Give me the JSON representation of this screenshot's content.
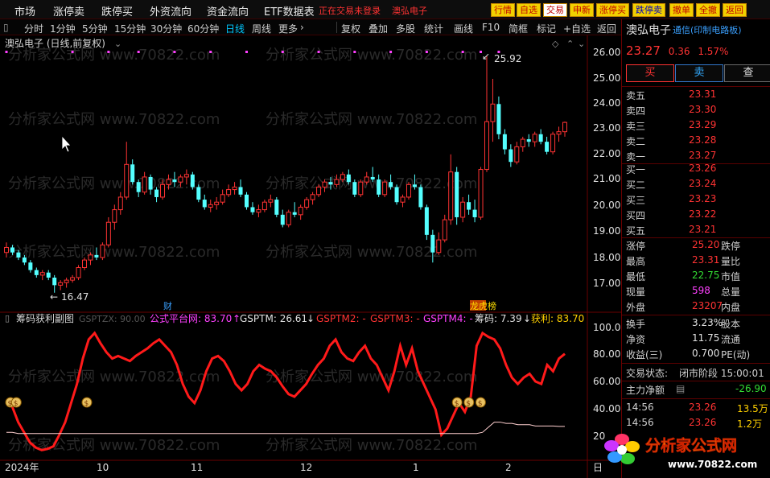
{
  "menu": {
    "items": [
      "市场",
      "涨停卖",
      "跌停买",
      "外资流向",
      "资金流向",
      "ETF数据表"
    ],
    "warning": "正在交易未登录",
    "stock_hint": "澳弘电子"
  },
  "toolbar": {
    "buttons": [
      "行情",
      "自选",
      "交易",
      "申新",
      "涨停买",
      "跌停卖",
      "撤单",
      "全撤",
      "返回"
    ]
  },
  "period_bar": {
    "items": [
      "分时",
      "1分钟",
      "5分钟",
      "15分钟",
      "30分钟",
      "60分钟",
      "日线",
      "周线",
      "更多"
    ],
    "active": "日线",
    "tools": [
      "复权",
      "叠加",
      "多股",
      "统计",
      "画线",
      "F10",
      "简框",
      "标记",
      "+自选",
      "返回"
    ]
  },
  "main_chart": {
    "title": "澳弘电子 (日线,前复权)",
    "watermark": "分析家公式网 www.70822.com",
    "high_label": "25.92",
    "low_label": "16.47",
    "marker_cai": "财",
    "marker_ban": "龙虎榜",
    "y_ticks": [
      "26.00",
      "25.00",
      "24.00",
      "23.00",
      "22.00",
      "21.00",
      "20.00",
      "19.00",
      "18.00",
      "17.00"
    ]
  },
  "sub_chart": {
    "title": "筹码获利副图",
    "params": "GSPTZX: 90.00",
    "legend": [
      {
        "text": "公式平台网: 83.70",
        "color": "#ff40ff"
      },
      {
        "text": "GSPTM: 26.61",
        "color": "#e0e0e0"
      },
      {
        "text": "GSPTM2: -",
        "color": "#ff3333"
      },
      {
        "text": "GSPTM3: -",
        "color": "#ff3333"
      },
      {
        "text": "GSPTM4: -",
        "color": "#ff40ff"
      },
      {
        "text": "筹码: 7.39",
        "color": "#e0e0e0"
      },
      {
        "text": "获利: 83.70",
        "color": "#ffd000"
      }
    ],
    "y_ticks": [
      "100.0",
      "80.00",
      "60.00",
      "40.00",
      "20"
    ]
  },
  "x_axis": {
    "labels": [
      "2024年",
      "10",
      "11",
      "12",
      "1",
      "2"
    ],
    "right_label": "日"
  },
  "quote": {
    "name": "澳弘电子",
    "category": "通信(印制电路板)",
    "price": "23.27",
    "change": "0.36",
    "change_pct": "1.57%",
    "buttons": [
      "买",
      "卖",
      "查"
    ],
    "sell_levels": [
      {
        "label": "卖五",
        "price": "23.31"
      },
      {
        "label": "卖四",
        "price": "23.30"
      },
      {
        "label": "卖三",
        "price": "23.29"
      },
      {
        "label": "卖二",
        "price": "23.28"
      },
      {
        "label": "卖一",
        "price": "23.27"
      }
    ],
    "buy_levels": [
      {
        "label": "买一",
        "price": "23.26"
      },
      {
        "label": "买二",
        "price": "23.24"
      },
      {
        "label": "买三",
        "price": "23.23"
      },
      {
        "label": "买四",
        "price": "23.22"
      },
      {
        "label": "买五",
        "price": "23.21"
      }
    ],
    "stats": [
      {
        "label": "涨停",
        "value": "25.20",
        "label2": "跌停",
        "color": "#ff3333"
      },
      {
        "label": "最高",
        "value": "23.31",
        "label2": "量比",
        "color": "#ff3333"
      },
      {
        "label": "最低",
        "value": "22.75",
        "label2": "市值",
        "color": "#33dd33"
      },
      {
        "label": "现量",
        "value": "598",
        "label2": "总量",
        "color": "#ff40ff"
      },
      {
        "label": "外盘",
        "value": "23207",
        "label2": "内盘",
        "color": "#ff3333"
      }
    ],
    "stats2": [
      {
        "label": "换手",
        "value": "3.23%",
        "label2": "股本",
        "color": "#e0e0e0"
      },
      {
        "label": "净资",
        "value": "11.75",
        "label2": "流通",
        "color": "#e0e0e0"
      },
      {
        "label": "收益(三)",
        "value": "0.700",
        "label2": "PE(动)",
        "color": "#e0e0e0"
      }
    ],
    "status_label": "交易状态:",
    "status_value": "闭市阶段 15:00:01",
    "net_label": "主力净额",
    "net_value": "-26.90",
    "ticks": [
      {
        "time": "14:56",
        "price": "23.26",
        "vol": "13.5万"
      },
      {
        "time": "14:56",
        "price": "23.26",
        "vol": "1.2万"
      }
    ]
  },
  "logo": {
    "name": "分析家公式网",
    "url": "www.70822.com"
  },
  "colors": {
    "up": "#ff3333",
    "down": "#54ffff",
    "line": "#ff1a1a",
    "accent": "#00c8ff"
  },
  "chart_data": {
    "type": "candlestick",
    "price_range": [
      16.3,
      26.6
    ],
    "candles": [
      [
        18.1,
        18.5,
        17.9,
        18.3
      ],
      [
        18.3,
        18.4,
        18.0,
        18.1
      ],
      [
        18.1,
        18.2,
        17.8,
        17.9
      ],
      [
        17.9,
        18.0,
        17.6,
        17.7
      ],
      [
        17.7,
        17.8,
        17.3,
        17.4
      ],
      [
        17.4,
        17.5,
        17.1,
        17.2
      ],
      [
        17.2,
        17.4,
        17.0,
        17.3
      ],
      [
        17.3,
        17.4,
        17.0,
        17.1
      ],
      [
        17.1,
        17.2,
        16.5,
        16.8
      ],
      [
        16.8,
        17.0,
        16.6,
        16.9
      ],
      [
        16.9,
        17.1,
        16.7,
        17.0
      ],
      [
        17.0,
        17.2,
        16.9,
        17.1
      ],
      [
        17.1,
        17.6,
        17.0,
        17.5
      ],
      [
        17.5,
        17.9,
        17.4,
        17.8
      ],
      [
        17.8,
        18.1,
        17.6,
        18.0
      ],
      [
        18.0,
        18.3,
        17.8,
        17.9
      ],
      [
        17.9,
        18.5,
        17.8,
        18.4
      ],
      [
        18.4,
        19.5,
        18.3,
        19.3
      ],
      [
        19.3,
        20.0,
        19.0,
        19.8
      ],
      [
        19.8,
        20.5,
        19.6,
        20.3
      ],
      [
        20.3,
        22.5,
        20.2,
        21.6
      ],
      [
        21.6,
        21.8,
        20.8,
        20.9
      ],
      [
        20.9,
        21.0,
        20.3,
        20.5
      ],
      [
        20.5,
        21.3,
        20.4,
        21.1
      ],
      [
        21.1,
        21.2,
        20.4,
        20.6
      ],
      [
        20.6,
        20.7,
        20.1,
        20.3
      ],
      [
        20.3,
        21.0,
        20.2,
        20.8
      ],
      [
        20.8,
        21.2,
        20.6,
        21.0
      ],
      [
        21.0,
        21.3,
        20.7,
        20.9
      ],
      [
        20.9,
        21.2,
        20.7,
        21.1
      ],
      [
        21.1,
        21.4,
        20.8,
        21.2
      ],
      [
        21.2,
        21.3,
        20.6,
        20.7
      ],
      [
        20.7,
        20.8,
        20.1,
        20.2
      ],
      [
        20.2,
        20.4,
        19.8,
        19.9
      ],
      [
        19.9,
        20.2,
        19.7,
        20.0
      ],
      [
        20.0,
        20.3,
        19.8,
        20.1
      ],
      [
        20.1,
        20.6,
        20.0,
        20.4
      ],
      [
        20.4,
        20.8,
        20.3,
        20.6
      ],
      [
        20.6,
        20.9,
        20.4,
        20.7
      ],
      [
        20.7,
        21.0,
        20.3,
        20.4
      ],
      [
        20.4,
        20.5,
        19.8,
        19.9
      ],
      [
        19.9,
        20.1,
        19.6,
        19.7
      ],
      [
        19.7,
        20.0,
        19.5,
        19.8
      ],
      [
        19.8,
        20.2,
        19.7,
        20.1
      ],
      [
        20.1,
        20.4,
        19.9,
        20.2
      ],
      [
        20.2,
        20.3,
        19.5,
        19.6
      ],
      [
        19.6,
        19.8,
        19.1,
        19.2
      ],
      [
        19.2,
        19.8,
        19.1,
        19.7
      ],
      [
        19.7,
        20.1,
        19.5,
        19.6
      ],
      [
        19.6,
        20.0,
        19.4,
        19.9
      ],
      [
        19.9,
        20.3,
        19.8,
        20.2
      ],
      [
        20.2,
        20.5,
        20.0,
        20.4
      ],
      [
        20.4,
        20.8,
        20.3,
        20.7
      ],
      [
        20.7,
        21.0,
        20.5,
        20.9
      ],
      [
        20.9,
        21.1,
        20.6,
        20.8
      ],
      [
        20.8,
        21.2,
        20.7,
        21.0
      ],
      [
        21.0,
        21.3,
        20.9,
        21.2
      ],
      [
        21.2,
        21.4,
        20.8,
        20.9
      ],
      [
        20.9,
        21.0,
        20.3,
        20.4
      ],
      [
        20.4,
        21.0,
        20.3,
        20.9
      ],
      [
        20.9,
        21.3,
        20.8,
        21.1
      ],
      [
        21.1,
        21.5,
        20.9,
        21.0
      ],
      [
        21.0,
        21.2,
        20.3,
        20.4
      ],
      [
        20.4,
        21.0,
        20.3,
        20.9
      ],
      [
        20.9,
        21.2,
        20.6,
        20.7
      ],
      [
        20.7,
        20.8,
        20.0,
        20.1
      ],
      [
        20.1,
        20.4,
        19.9,
        20.3
      ],
      [
        20.3,
        20.9,
        20.2,
        20.8
      ],
      [
        20.8,
        21.2,
        20.6,
        20.7
      ],
      [
        20.7,
        20.8,
        19.8,
        19.9
      ],
      [
        19.9,
        20.0,
        18.6,
        18.8
      ],
      [
        18.8,
        19.0,
        17.7,
        18.1
      ],
      [
        18.1,
        18.9,
        18.0,
        18.6
      ],
      [
        18.6,
        19.6,
        18.5,
        19.4
      ],
      [
        19.4,
        22.0,
        19.2,
        21.3
      ],
      [
        21.3,
        21.5,
        19.2,
        19.5
      ],
      [
        19.5,
        20.3,
        19.3,
        20.1
      ],
      [
        20.1,
        20.4,
        19.6,
        19.8
      ],
      [
        19.8,
        20.2,
        19.3,
        19.5
      ],
      [
        19.5,
        21.5,
        19.4,
        21.4
      ],
      [
        21.4,
        25.9,
        21.3,
        23.3
      ],
      [
        23.3,
        25.0,
        22.5,
        24.0
      ],
      [
        24.0,
        24.3,
        22.6,
        22.8
      ],
      [
        22.8,
        23.0,
        22.0,
        22.2
      ],
      [
        22.2,
        22.4,
        21.5,
        21.7
      ],
      [
        21.7,
        22.5,
        21.6,
        22.3
      ],
      [
        22.3,
        22.7,
        22.1,
        22.6
      ],
      [
        22.6,
        22.8,
        22.3,
        22.5
      ],
      [
        22.5,
        22.9,
        22.3,
        22.8
      ],
      [
        22.8,
        23.0,
        22.4,
        22.5
      ],
      [
        22.5,
        22.7,
        22.0,
        22.1
      ],
      [
        22.1,
        22.9,
        22.0,
        22.8
      ],
      [
        22.8,
        23.1,
        22.5,
        22.9
      ],
      [
        22.9,
        23.3,
        22.7,
        23.27
      ]
    ],
    "series": [
      {
        "name": "公式平台网",
        "values": [
          45,
          42,
          30,
          22,
          14,
          10,
          8,
          9,
          11,
          20,
          30,
          45,
          60,
          80,
          95,
          100,
          92,
          85,
          80,
          82,
          80,
          78,
          82,
          85,
          88,
          92,
          95,
          90,
          85,
          75,
          60,
          50,
          45,
          55,
          70,
          80,
          82,
          78,
          70,
          60,
          55,
          60,
          70,
          75,
          72,
          70,
          65,
          58,
          52,
          50,
          55,
          60,
          68,
          75,
          80,
          90,
          95,
          85,
          80,
          78,
          85,
          90,
          80,
          75,
          65,
          55,
          70,
          90,
          75,
          88,
          70,
          60,
          50,
          40,
          20,
          25,
          35,
          45,
          38,
          50,
          90,
          100,
          97,
          95,
          88,
          75,
          65,
          60,
          65,
          68,
          62,
          60,
          75,
          70,
          80,
          83.7
        ]
      },
      {
        "name": "GSPTM",
        "values": [
          22,
          22,
          21,
          21,
          21,
          21,
          21,
          21,
          21,
          21,
          21,
          21,
          21,
          21,
          21,
          21,
          21,
          21,
          21,
          21,
          21,
          21,
          21,
          21,
          21,
          21,
          21,
          21,
          21,
          21,
          21,
          21,
          21,
          21,
          21,
          21,
          21,
          21,
          21,
          21,
          21,
          21,
          21,
          21,
          21,
          21,
          21,
          21,
          21,
          21,
          21,
          21,
          21,
          21,
          21,
          21,
          21,
          21,
          21,
          21,
          21,
          21,
          21,
          21,
          21,
          21,
          21,
          21,
          21,
          21,
          21,
          21,
          21,
          21,
          21,
          21,
          21,
          21,
          21,
          21,
          21,
          22,
          26,
          30,
          30,
          29,
          29,
          28,
          28,
          28,
          27,
          27,
          27,
          27,
          26.61,
          26.61
        ]
      }
    ],
    "ylim": [
      0,
      105
    ]
  }
}
